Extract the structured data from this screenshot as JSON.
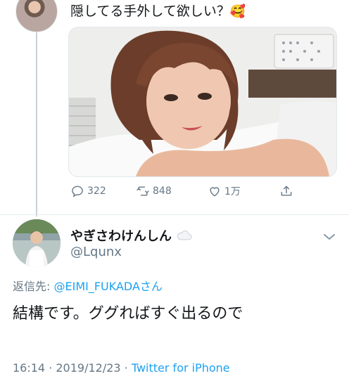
{
  "tweet": {
    "text": "隠してる手外して欲しい？",
    "emoji": "🥰",
    "actions": {
      "replies": "322",
      "retweets": "848",
      "likes": "1万"
    }
  },
  "reply": {
    "display_name": "やぎさわけんしん",
    "handle": "@Lqunx",
    "reply_to_label": "返信先: ",
    "reply_to_mention": "@EIMI_FUKADAさん",
    "text": "結構です。ググればすぐ出るので",
    "time": "16:14 · 2019/12/23 · ",
    "source": "Twitter for iPhone"
  },
  "colors": {
    "accent": "#1da1f2",
    "secondary_text": "#657786",
    "primary_text": "#14171a"
  },
  "icons": [
    "reply-icon",
    "retweet-icon",
    "like-icon",
    "share-icon",
    "cloud-icon",
    "chevron-down-icon"
  ]
}
